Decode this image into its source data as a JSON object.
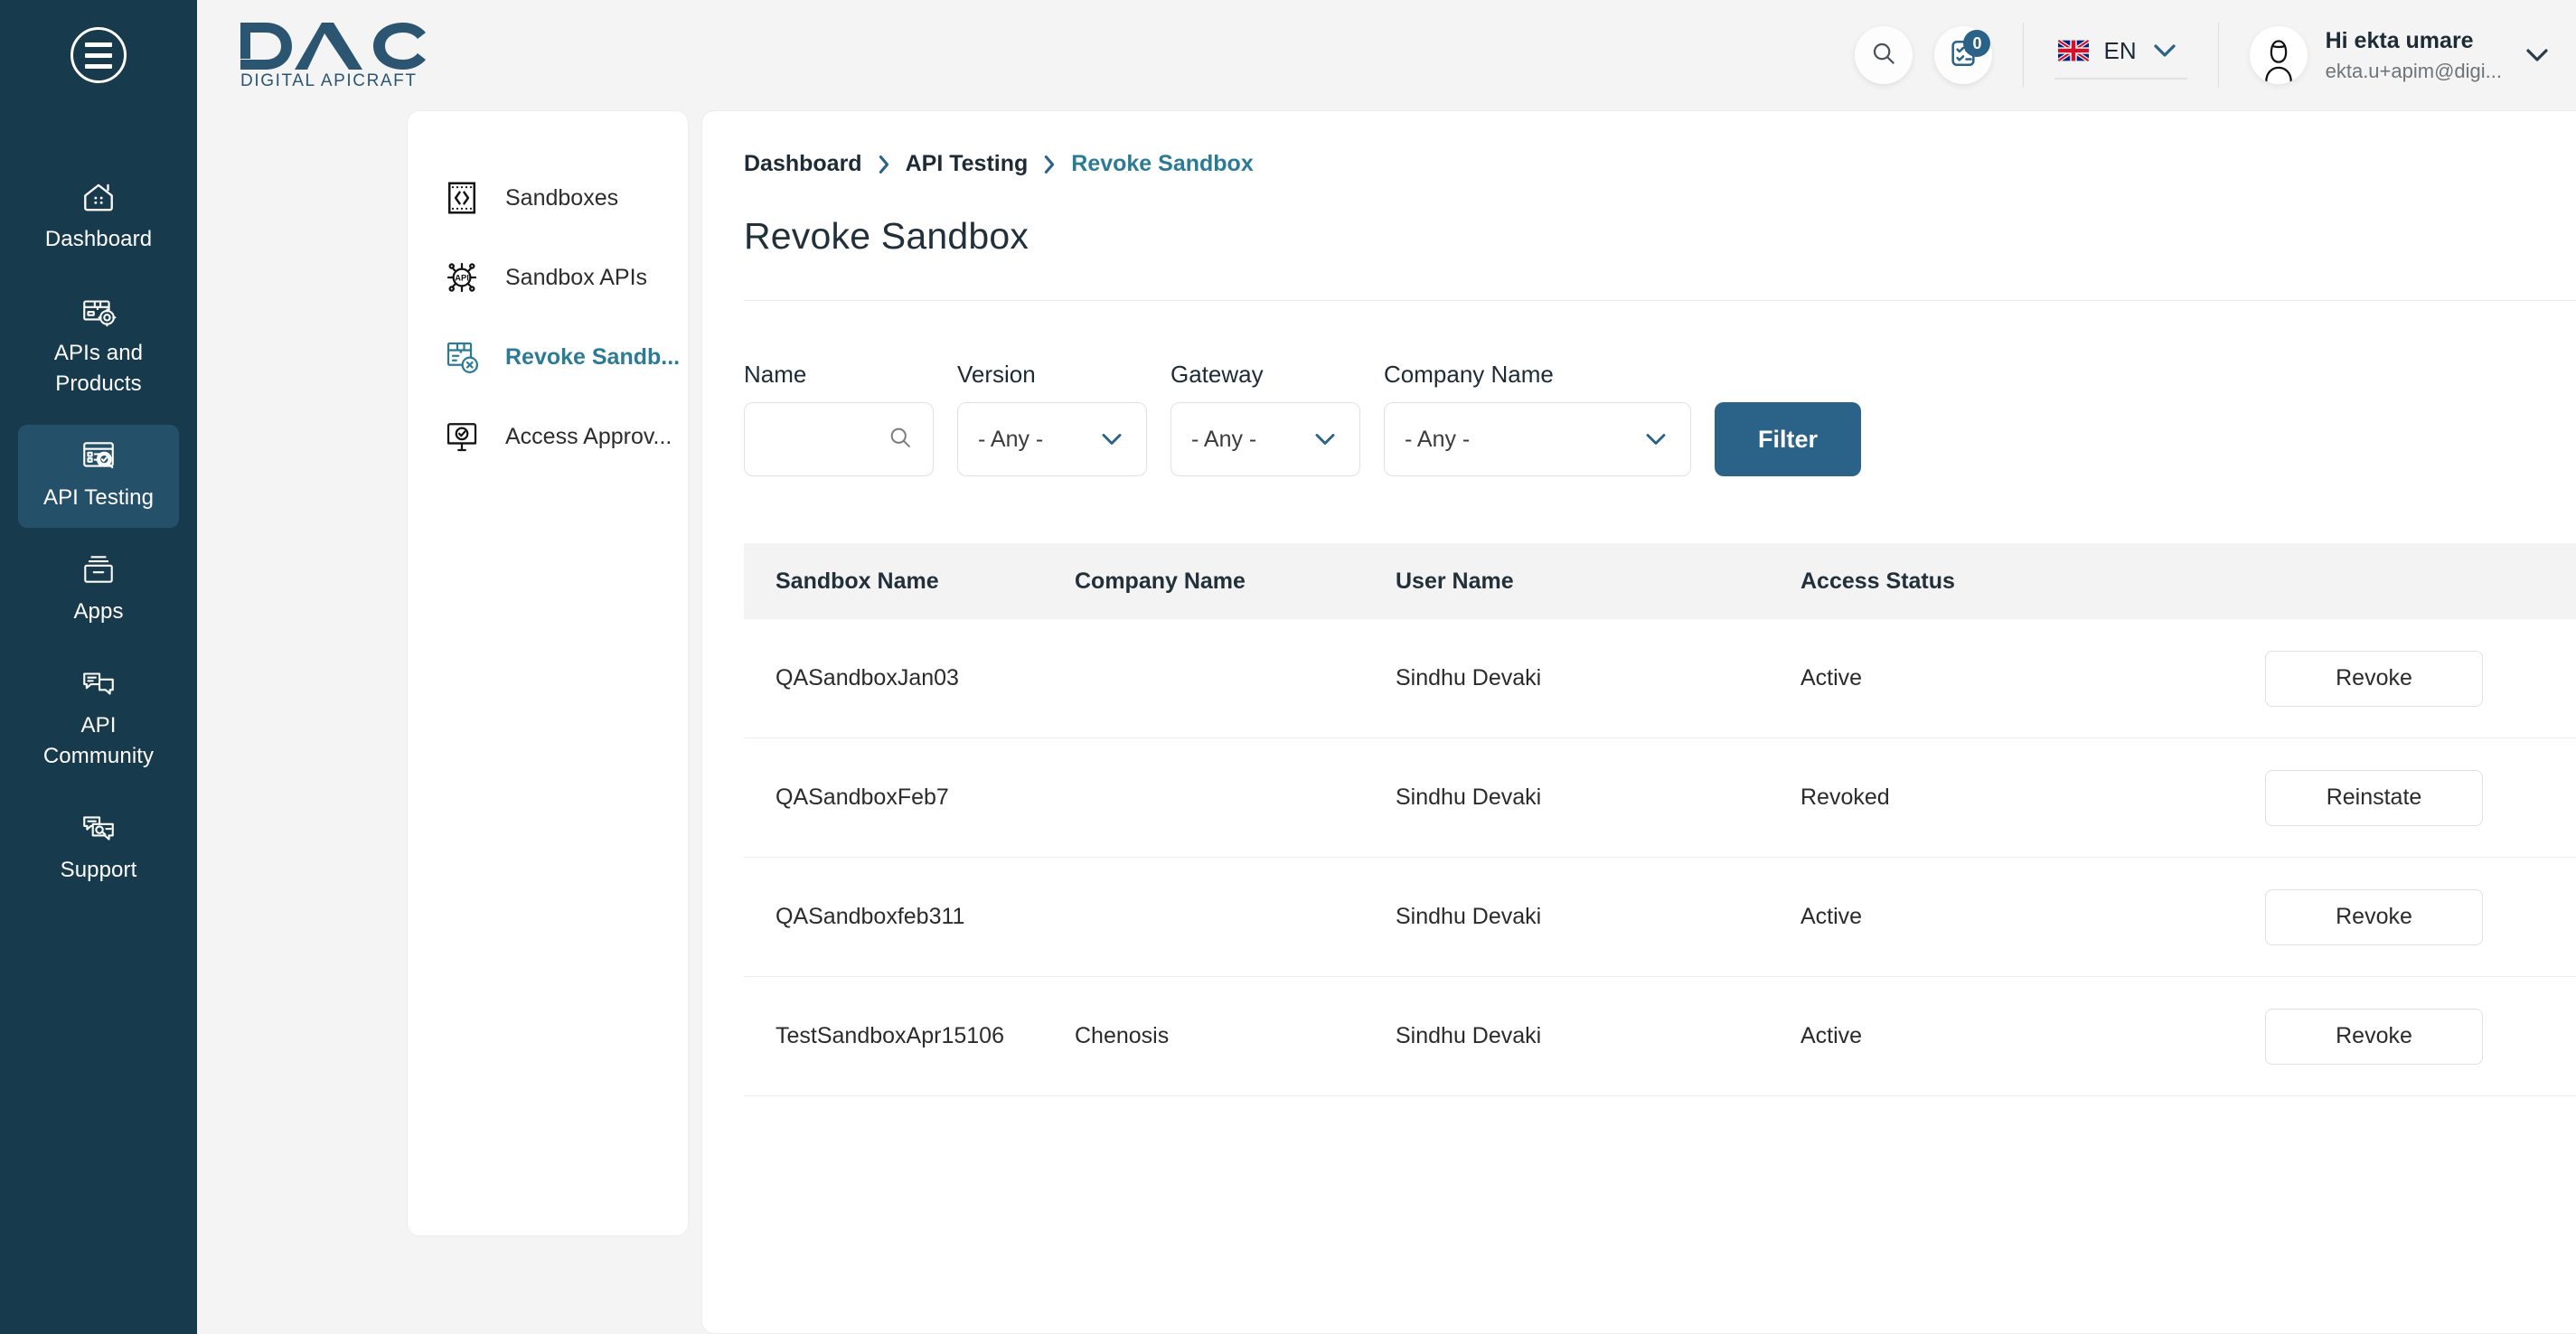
{
  "rail": {
    "menu_toggle": "menu-toggle",
    "items": [
      {
        "label": "Dashboard",
        "icon": "home-icon",
        "active": false
      },
      {
        "label": "APIs and Products",
        "icon": "apis-products-icon",
        "active": false
      },
      {
        "label": "API Testing",
        "icon": "api-testing-icon",
        "active": true
      },
      {
        "label": "Apps",
        "icon": "apps-icon",
        "active": false
      },
      {
        "label": "API Community",
        "icon": "community-icon",
        "active": false
      },
      {
        "label": "Support",
        "icon": "support-icon",
        "active": false
      }
    ]
  },
  "header": {
    "logo_title": "DAC",
    "logo_subtitle": "DIGITAL APICRAFT",
    "search_icon": "search-icon",
    "tasks_icon": "tasks-icon",
    "notification_count": "0",
    "language": "EN",
    "language_flag": "uk-flag-icon",
    "user_greeting": "Hi ekta umare",
    "user_email": "ekta.u+apim@digi...",
    "avatar_icon": "avatar-icon"
  },
  "subnav": {
    "items": [
      {
        "label": "Sandboxes",
        "icon": "code-sandbox-icon",
        "active": false
      },
      {
        "label": "Sandbox APIs",
        "icon": "api-chip-icon",
        "active": false
      },
      {
        "label": "Revoke Sandb...",
        "icon": "revoke-sandbox-icon",
        "active": true
      },
      {
        "label": "Access Approv...",
        "icon": "access-approval-icon",
        "active": false
      }
    ]
  },
  "breadcrumb": {
    "items": [
      "Dashboard",
      "API Testing",
      "Revoke Sandbox"
    ]
  },
  "page": {
    "title": "Revoke Sandbox"
  },
  "filters": {
    "name": {
      "label": "Name",
      "value": "",
      "placeholder": ""
    },
    "version": {
      "label": "Version",
      "value": "- Any -"
    },
    "gateway": {
      "label": "Gateway",
      "value": "- Any -"
    },
    "company": {
      "label": "Company Name",
      "value": "- Any -"
    },
    "submit_label": "Filter"
  },
  "table": {
    "columns": [
      "Sandbox Name",
      "Company Name",
      "User Name",
      "Access Status",
      ""
    ],
    "rows": [
      {
        "sandbox_name": "QASandboxJan03",
        "company_name": "",
        "user_name": "Sindhu Devaki",
        "access_status": "Active",
        "action_label": "Revoke"
      },
      {
        "sandbox_name": "QASandboxFeb7",
        "company_name": "",
        "user_name": "Sindhu Devaki",
        "access_status": "Revoked",
        "action_label": "Reinstate"
      },
      {
        "sandbox_name": "QASandboxfeb311",
        "company_name": "",
        "user_name": "Sindhu Devaki",
        "access_status": "Active",
        "action_label": "Revoke"
      },
      {
        "sandbox_name": "TestSandboxApr15106",
        "company_name": "Chenosis",
        "user_name": "Sindhu Devaki",
        "access_status": "Active",
        "action_label": "Revoke"
      }
    ]
  },
  "colors": {
    "rail_bg": "#173a4d",
    "rail_active": "#245069",
    "accent": "#2b7b94",
    "primary_button": "#2b6287",
    "page_bg": "#f4f4f4",
    "table_header_bg": "#f3f3f3"
  }
}
